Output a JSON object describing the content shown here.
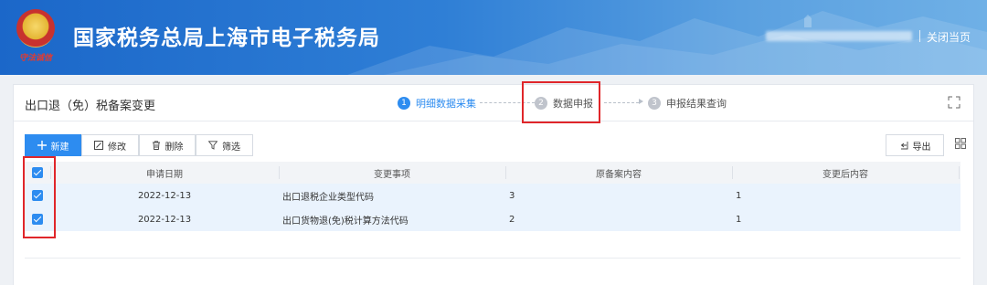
{
  "header": {
    "site_title": "国家税务总局上海市电子税务局",
    "close_page": "关闭当页",
    "emblem_signature": "守法诚信"
  },
  "panel": {
    "title": "出口退（免）税备案变更",
    "steps": [
      {
        "num": "1",
        "label": "明细数据采集",
        "state": "active"
      },
      {
        "num": "2",
        "label": "数据申报",
        "state": "idle"
      },
      {
        "num": "3",
        "label": "申报结果查询",
        "state": "idle"
      }
    ]
  },
  "toolbar": {
    "new_label": "新建",
    "edit_label": "修改",
    "delete_label": "删除",
    "filter_label": "筛选",
    "export_label": "导出"
  },
  "table": {
    "headers": {
      "date": "申请日期",
      "item": "变更事项",
      "old": "原备案内容",
      "new": "变更后内容"
    },
    "rows": [
      {
        "date": "2022-12-13",
        "item": "出口退税企业类型代码",
        "old": "3",
        "new": "1",
        "checked": true
      },
      {
        "date": "2022-12-13",
        "item": "出口货物退(免)税计算方法代码",
        "old": "2",
        "new": "1",
        "checked": true
      }
    ],
    "header_checked": true
  },
  "colors": {
    "accent": "#2d8cf0",
    "header_blue": "#1b67c9",
    "highlight_red": "#e0262a",
    "selected_row": "#eaf3fd"
  }
}
